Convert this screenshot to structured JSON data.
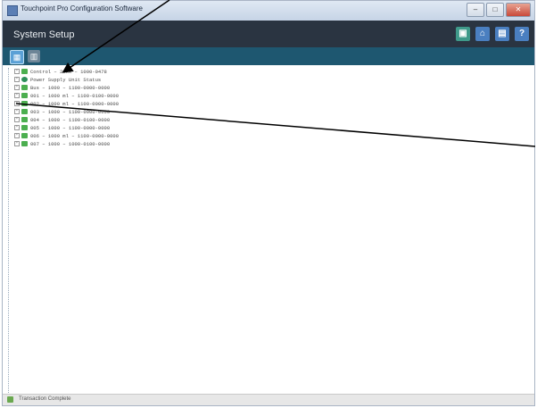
{
  "window": {
    "title": "Touchpoint Pro Configuration Software"
  },
  "header": {
    "title": "System Setup"
  },
  "tree": {
    "items": [
      "Control – 2xxx – 1000-0478",
      "Power Supply Unit Status",
      "Bus – 1000 – 1100-0000-0000",
      "001 – 1000 ml – 1100-0100-0000",
      "002 – 1000 ml – 1100-0000-0000",
      "003 – 1000 – 1100-0000-0000",
      "004 – 1000 – 1100-0100-0000",
      "005 – 1000 – 1100-0000-0000",
      "006 – 1000 ml – 1100-0000-0000",
      "007 – 1000 – 1000-0100-0000"
    ]
  },
  "status": {
    "text": "Transaction Complete"
  },
  "colors": {
    "header": "#2a3441",
    "toolbar": "#1e5770",
    "accent": "#4caf50"
  }
}
